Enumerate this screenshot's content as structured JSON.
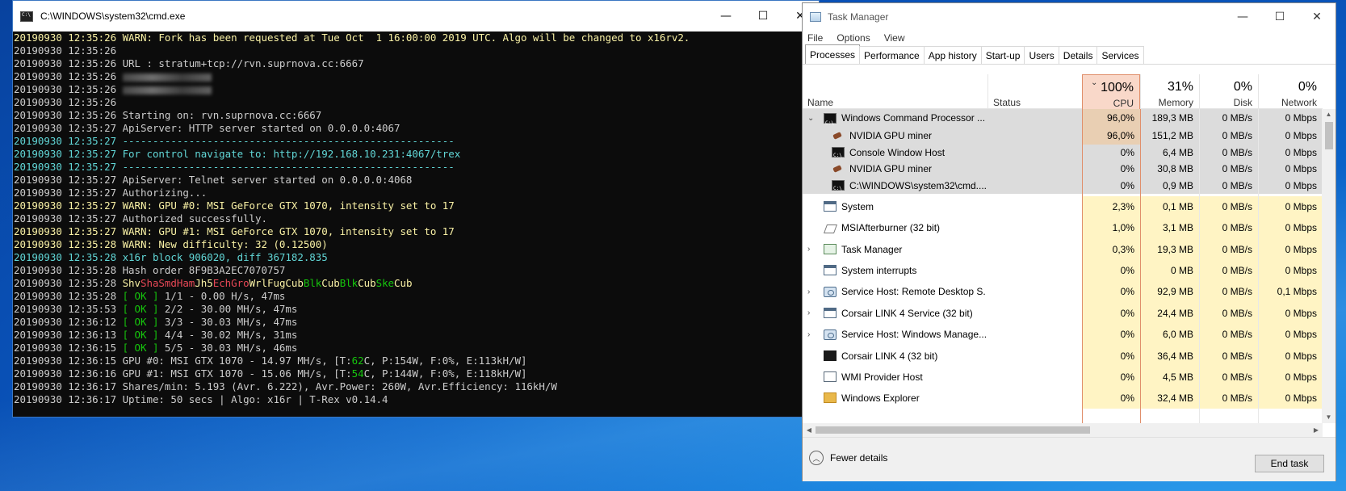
{
  "cmd": {
    "title": "C:\\WINDOWS\\system32\\cmd.exe",
    "lines": [
      {
        "ts": "20190930 12:35:26 ",
        "parts": [
          {
            "c": "cw",
            "t": "WARN: Fork has been requested at Tue Oct  1 16:00:00 2019 UTC. Algo will be changed to x16rv2."
          }
        ],
        "tc": "cw"
      },
      {
        "ts": "20190930 12:35:26",
        "parts": [],
        "tc": ""
      },
      {
        "ts": "20190930 12:35:26 ",
        "parts": [
          {
            "c": "",
            "t": "URL : stratum+tcp://rvn.suprnova.cc:6667"
          }
        ],
        "tc": ""
      },
      {
        "ts": "20190930 12:35:26 ",
        "parts": [
          {
            "c": "blur",
            "t": ""
          }
        ],
        "tc": ""
      },
      {
        "ts": "20190930 12:35:26 ",
        "parts": [
          {
            "c": "blur",
            "t": ""
          }
        ],
        "tc": ""
      },
      {
        "ts": "20190930 12:35:26",
        "parts": [],
        "tc": ""
      },
      {
        "ts": "20190930 12:35:26 ",
        "parts": [
          {
            "c": "",
            "t": "Starting on: rvn.suprnova.cc:6667"
          }
        ],
        "tc": ""
      },
      {
        "ts": "20190930 12:35:27 ",
        "parts": [
          {
            "c": "",
            "t": "ApiServer: HTTP server started on 0.0.0.0:4067"
          }
        ],
        "tc": ""
      },
      {
        "ts": "20190930 12:35:27 ",
        "parts": [
          {
            "c": "cc",
            "t": "-------------------------------------------------------"
          }
        ],
        "tc": "cc"
      },
      {
        "ts": "20190930 12:35:27 ",
        "parts": [
          {
            "c": "cc",
            "t": "For control navigate to: http://192.168.10.231:4067/trex"
          }
        ],
        "tc": "cc"
      },
      {
        "ts": "20190930 12:35:27 ",
        "parts": [
          {
            "c": "cc",
            "t": "-------------------------------------------------------"
          }
        ],
        "tc": "cc"
      },
      {
        "ts": "20190930 12:35:27 ",
        "parts": [
          {
            "c": "",
            "t": "ApiServer: Telnet server started on 0.0.0.0:4068"
          }
        ],
        "tc": ""
      },
      {
        "ts": "20190930 12:35:27 ",
        "parts": [
          {
            "c": "",
            "t": "Authorizing..."
          }
        ],
        "tc": ""
      },
      {
        "ts": "20190930 12:35:27 ",
        "parts": [
          {
            "c": "cw",
            "t": "WARN: GPU #0: MSI GeForce GTX 1070, intensity set to 17"
          }
        ],
        "tc": "cw"
      },
      {
        "ts": "20190930 12:35:27 ",
        "parts": [
          {
            "c": "",
            "t": "Authorized successfully."
          }
        ],
        "tc": ""
      },
      {
        "ts": "20190930 12:35:27 ",
        "parts": [
          {
            "c": "cw",
            "t": "WARN: GPU #1: MSI GeForce GTX 1070, intensity set to 17"
          }
        ],
        "tc": "cw"
      },
      {
        "ts": "20190930 12:35:28 ",
        "parts": [
          {
            "c": "cw",
            "t": "WARN: New difficulty: 32 (0.12500)"
          }
        ],
        "tc": "cw"
      },
      {
        "ts": "20190930 12:35:28 ",
        "parts": [
          {
            "c": "cc",
            "t": "x16r block 906020, diff 367182.835"
          }
        ],
        "tc": "cc"
      },
      {
        "ts": "20190930 12:35:28 ",
        "parts": [
          {
            "c": "",
            "t": "Hash order 8F9B3A2EC7070757"
          }
        ],
        "tc": ""
      },
      {
        "ts": "20190930 12:35:28 ",
        "parts": [
          {
            "c": "cy",
            "t": "Shv"
          },
          {
            "c": "cr",
            "t": "ShaSmdHam"
          },
          {
            "c": "cy",
            "t": "Jh5"
          },
          {
            "c": "cr",
            "t": "EchGro"
          },
          {
            "c": "cy",
            "t": "WrlFugCub"
          },
          {
            "c": "cg",
            "t": "Blk"
          },
          {
            "c": "cy",
            "t": "Cub"
          },
          {
            "c": "cg",
            "t": "Blk"
          },
          {
            "c": "cy",
            "t": "Cub"
          },
          {
            "c": "cg",
            "t": "Ske"
          },
          {
            "c": "cy",
            "t": "Cub"
          }
        ],
        "tc": ""
      },
      {
        "ts": "20190930 12:35:28 ",
        "parts": [
          {
            "c": "cg",
            "t": "[ OK ]"
          },
          {
            "c": "",
            "t": " 1/1 - 0.00 H/s, 47ms"
          }
        ],
        "tc": ""
      },
      {
        "ts": "20190930 12:35:53 ",
        "parts": [
          {
            "c": "cg",
            "t": "[ OK ]"
          },
          {
            "c": "",
            "t": " 2/2 - 30.00 MH/s, 47ms"
          }
        ],
        "tc": ""
      },
      {
        "ts": "20190930 12:36:12 ",
        "parts": [
          {
            "c": "cg",
            "t": "[ OK ]"
          },
          {
            "c": "",
            "t": " 3/3 - 30.03 MH/s, 47ms"
          }
        ],
        "tc": ""
      },
      {
        "ts": "20190930 12:36:13 ",
        "parts": [
          {
            "c": "cg",
            "t": "[ OK ]"
          },
          {
            "c": "",
            "t": " 4/4 - 30.02 MH/s, 31ms"
          }
        ],
        "tc": ""
      },
      {
        "ts": "20190930 12:36:15 ",
        "parts": [
          {
            "c": "cg",
            "t": "[ OK ]"
          },
          {
            "c": "",
            "t": " 5/5 - 30.03 MH/s, 46ms"
          }
        ],
        "tc": ""
      },
      {
        "ts": "20190930 12:36:15 ",
        "parts": [
          {
            "c": "",
            "t": "GPU #0: MSI GTX 1070 - 14.97 MH/s, [T:"
          },
          {
            "c": "cg",
            "t": "62"
          },
          {
            "c": "",
            "t": "C, P:154W, F:0%, E:113kH/W]"
          }
        ],
        "tc": ""
      },
      {
        "ts": "20190930 12:36:16 ",
        "parts": [
          {
            "c": "",
            "t": "GPU #1: MSI GTX 1070 - 15.06 MH/s, [T:"
          },
          {
            "c": "cg",
            "t": "54"
          },
          {
            "c": "",
            "t": "C, P:144W, F:0%, E:118kH/W]"
          }
        ],
        "tc": ""
      },
      {
        "ts": "20190930 12:36:17 ",
        "parts": [
          {
            "c": "",
            "t": "Shares/min: 5.193 (Avr. 6.222), Avr.Power: 260W, Avr.Efficiency: 116kH/W"
          }
        ],
        "tc": ""
      },
      {
        "ts": "20190930 12:36:17 ",
        "parts": [
          {
            "c": "",
            "t": "Uptime: 50 secs | Algo: x16r | T-Rex v0.14.4"
          }
        ],
        "tc": ""
      }
    ]
  },
  "tm": {
    "title": "Task Manager",
    "menu": [
      "File",
      "Options",
      "View"
    ],
    "tabs": [
      "Processes",
      "Performance",
      "App history",
      "Start-up",
      "Users",
      "Details",
      "Services"
    ],
    "headers": {
      "name": "Name",
      "status": "Status",
      "cpu": {
        "pct": "100%",
        "label": "CPU"
      },
      "memory": {
        "pct": "31%",
        "label": "Memory"
      },
      "disk": {
        "pct": "0%",
        "label": "Disk"
      },
      "network": {
        "pct": "0%",
        "label": "Network"
      }
    },
    "rows": [
      {
        "name": "Windows Command Processor ...",
        "icon": "cmd",
        "indent": 0,
        "chev": "⌄",
        "group": true,
        "cpu": "96,0%",
        "mem": "189,3 MB",
        "disk": "0 MB/s",
        "net": "0 Mbps",
        "hot": true
      },
      {
        "name": "NVIDIA GPU miner",
        "icon": "nv",
        "indent": 1,
        "chev": "",
        "group": true,
        "cpu": "96,0%",
        "mem": "151,2 MB",
        "disk": "0 MB/s",
        "net": "0 Mbps",
        "hot": true
      },
      {
        "name": "Console Window Host",
        "icon": "cmd",
        "indent": 1,
        "chev": "",
        "group": true,
        "cpu": "0%",
        "mem": "6,4 MB",
        "disk": "0 MB/s",
        "net": "0 Mbps"
      },
      {
        "name": "NVIDIA GPU miner",
        "icon": "nv",
        "indent": 1,
        "chev": "",
        "group": true,
        "cpu": "0%",
        "mem": "30,8 MB",
        "disk": "0 MB/s",
        "net": "0 Mbps"
      },
      {
        "name": "C:\\WINDOWS\\system32\\cmd....",
        "icon": "cmd",
        "indent": 1,
        "chev": "",
        "group": true,
        "cpu": "0%",
        "mem": "0,9 MB",
        "disk": "0 MB/s",
        "net": "0 Mbps"
      },
      {
        "name": "System",
        "icon": "win",
        "indent": 0,
        "chev": "",
        "cpu": "2,3%",
        "mem": "0,1 MB",
        "disk": "0 MB/s",
        "net": "0 Mbps"
      },
      {
        "name": "MSIAfterburner (32 bit)",
        "icon": "msi",
        "indent": 0,
        "chev": "",
        "cpu": "1,0%",
        "mem": "3,1 MB",
        "disk": "0 MB/s",
        "net": "0 Mbps"
      },
      {
        "name": "Task Manager",
        "icon": "tm",
        "indent": 0,
        "chev": "›",
        "cpu": "0,3%",
        "mem": "19,3 MB",
        "disk": "0 MB/s",
        "net": "0 Mbps"
      },
      {
        "name": "System interrupts",
        "icon": "win",
        "indent": 0,
        "chev": "",
        "cpu": "0%",
        "mem": "0 MB",
        "disk": "0 MB/s",
        "net": "0 Mbps"
      },
      {
        "name": "Service Host: Remote Desktop S...",
        "icon": "gear",
        "indent": 0,
        "chev": "›",
        "cpu": "0%",
        "mem": "92,9 MB",
        "disk": "0 MB/s",
        "net": "0,1 Mbps"
      },
      {
        "name": "Corsair LINK 4 Service (32 bit)",
        "icon": "win",
        "indent": 0,
        "chev": "›",
        "cpu": "0%",
        "mem": "24,4 MB",
        "disk": "0 MB/s",
        "net": "0 Mbps"
      },
      {
        "name": "Service Host: Windows Manage...",
        "icon": "gear",
        "indent": 0,
        "chev": "›",
        "cpu": "0%",
        "mem": "6,0 MB",
        "disk": "0 MB/s",
        "net": "0 Mbps"
      },
      {
        "name": "Corsair LINK 4 (32 bit)",
        "icon": "cors",
        "indent": 0,
        "chev": "",
        "cpu": "0%",
        "mem": "36,4 MB",
        "disk": "0 MB/s",
        "net": "0 Mbps"
      },
      {
        "name": "WMI Provider Host",
        "icon": "wmi",
        "indent": 0,
        "chev": "",
        "cpu": "0%",
        "mem": "4,5 MB",
        "disk": "0 MB/s",
        "net": "0 Mbps"
      },
      {
        "name": "Windows Explorer",
        "icon": "exp",
        "indent": 0,
        "chev": "",
        "cpu": "0%",
        "mem": "32,4 MB",
        "disk": "0 MB/s",
        "net": "0 Mbps"
      }
    ],
    "footer": {
      "fewer": "Fewer details",
      "end_task": "End task"
    }
  }
}
